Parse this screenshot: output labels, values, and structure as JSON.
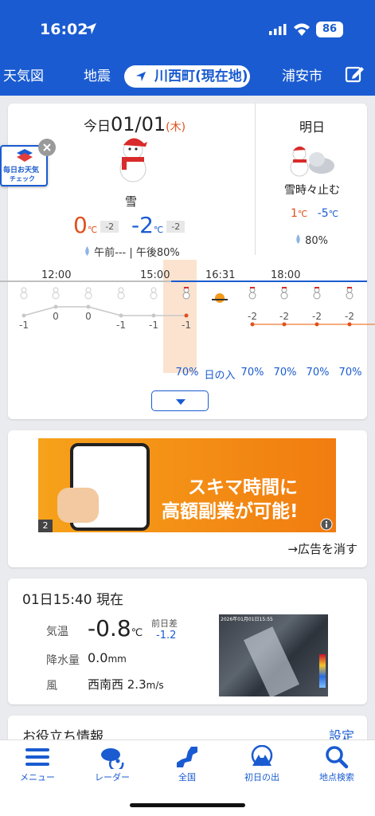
{
  "status_bar": {
    "time": "16:02",
    "battery": "86"
  },
  "tabs": [
    "天気図",
    "地震",
    "川西町(現在地)",
    "浦安市"
  ],
  "today": {
    "label": "今日",
    "date": "01/01",
    "weekday": "(木)",
    "weather": "雪",
    "high": "0",
    "high_diff": "-2",
    "low": "-2",
    "low_diff": "-2",
    "unit": "℃",
    "rain_text": "午前--- | 午後80%"
  },
  "tomorrow": {
    "label": "明日",
    "weather": "雪時々止む",
    "high": "1",
    "low": "-5",
    "unit": "℃",
    "rain": "80%"
  },
  "badge": {
    "line1": "毎日お天気",
    "line2": "チェック"
  },
  "hourly": {
    "hour_labels": [
      "12:00",
      "15:00",
      "16:31",
      "18:00"
    ],
    "temps": [
      "-1",
      "0",
      "0",
      "-1",
      "-1",
      "-1",
      "-2",
      "-2",
      "-2",
      "-2"
    ],
    "temp_values": [
      -1,
      0,
      0,
      -1,
      -1,
      -1,
      -2,
      -2,
      -2,
      -2
    ],
    "sunset_label": "日の入",
    "rain": [
      "70%",
      "70%",
      "70%",
      "70%",
      "70%"
    ]
  },
  "ad": {
    "line1": "スキマ時間に",
    "line2": "高額副業が可能!",
    "page": "2",
    "hide": "→広告を消す"
  },
  "current": {
    "title": "01日15:40 現在",
    "temp_label": "気温",
    "temp_value": "-0.8",
    "temp_unit": "℃",
    "diff_label": "前日差",
    "diff_value": "-1.2",
    "precip_label": "降水量",
    "precip_value": "0.0",
    "precip_unit": "mm",
    "wind_label": "風",
    "wind_value": "西南西 2.3",
    "wind_unit": "m/s",
    "radar_stamp": "2026年01月01日15:55"
  },
  "info": {
    "title": "お役立ち情報",
    "settings": "設定"
  },
  "nav": [
    "メニュー",
    "レーダー",
    "全国",
    "初日の出",
    "地点検索"
  ],
  "colors": {
    "brand": "#1a5bd1",
    "high": "#e0501c",
    "low": "#1a5bd1"
  }
}
